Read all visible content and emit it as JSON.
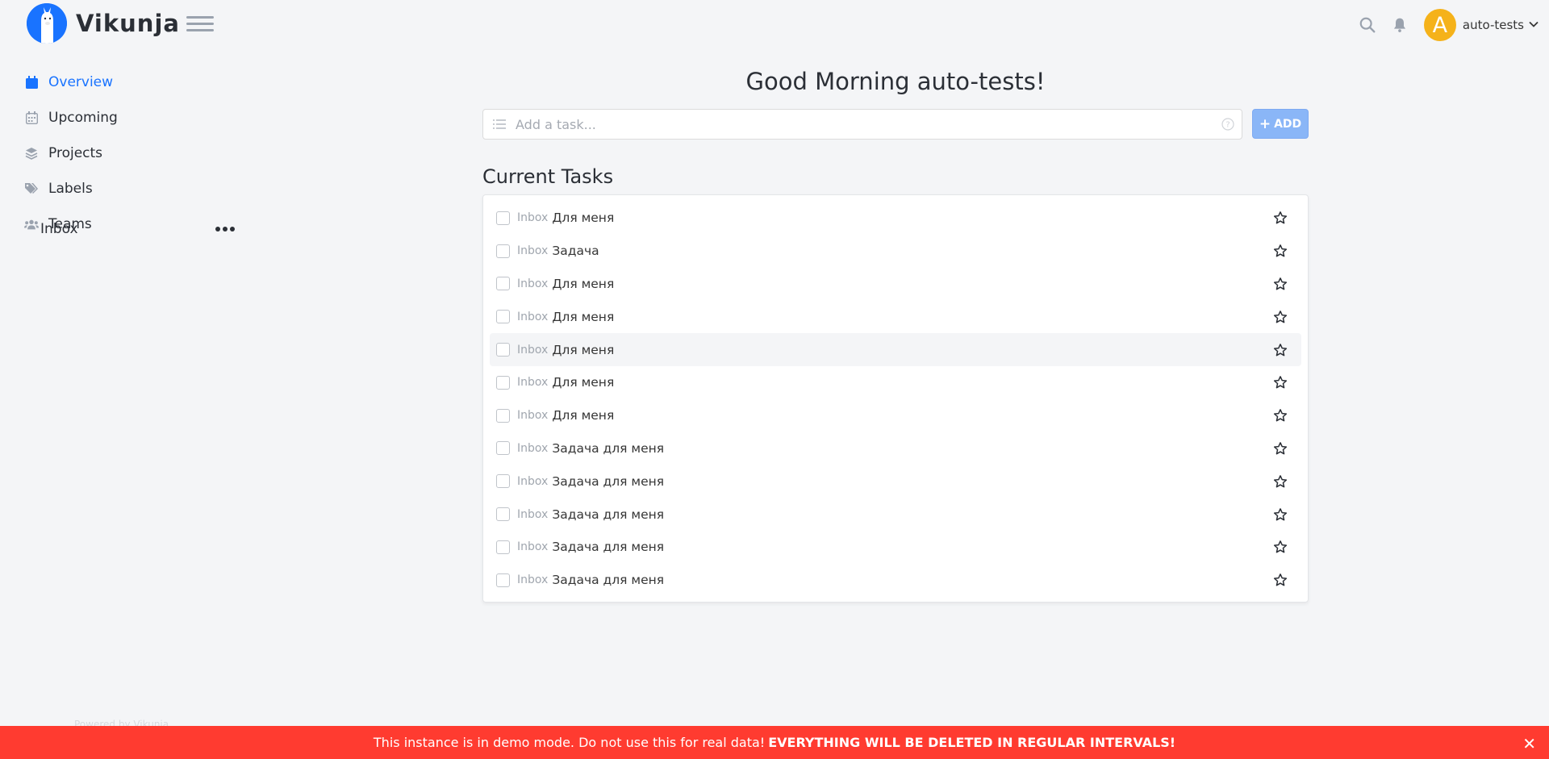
{
  "app": {
    "name": "Vikunja"
  },
  "header": {
    "username": "auto-tests",
    "avatar_letter": "A",
    "avatar_color": "#f5b21a"
  },
  "sidebar": {
    "items": [
      {
        "label": "Overview",
        "icon": "calendar-icon",
        "active": true
      },
      {
        "label": "Upcoming",
        "icon": "calendar-grid-icon"
      },
      {
        "label": "Projects",
        "icon": "layers-icon"
      },
      {
        "label": "Labels",
        "icon": "tags-icon"
      },
      {
        "label": "Teams",
        "icon": "users-icon"
      }
    ],
    "projects": [
      {
        "label": "Inbox"
      }
    ],
    "powered_by": "Powered by Vikunja"
  },
  "main": {
    "greeting": "Good Morning auto-tests!",
    "add_task": {
      "placeholder": "Add a task...",
      "button_label": "ADD",
      "button_icon": "+"
    },
    "section_title": "Current Tasks",
    "tasks": [
      {
        "project": "Inbox",
        "title": "Для меня"
      },
      {
        "project": "Inbox",
        "title": "Задача"
      },
      {
        "project": "Inbox",
        "title": "Для меня"
      },
      {
        "project": "Inbox",
        "title": "Для меня"
      },
      {
        "project": "Inbox",
        "title": "Для меня"
      },
      {
        "project": "Inbox",
        "title": "Для меня"
      },
      {
        "project": "Inbox",
        "title": "Для меня"
      },
      {
        "project": "Inbox",
        "title": "Задача для меня"
      },
      {
        "project": "Inbox",
        "title": "Задача для меня"
      },
      {
        "project": "Inbox",
        "title": "Задача для меня"
      },
      {
        "project": "Inbox",
        "title": "Задача для меня"
      },
      {
        "project": "Inbox",
        "title": "Задача для меня"
      }
    ]
  },
  "banner": {
    "text": "This instance is in demo mode. Do not use this for real data!",
    "emphasis": "EVERYTHING WILL BE DELETED IN REGULAR INTERVALS!",
    "close": "✕",
    "color": "#ff3b30"
  },
  "colors": {
    "accent": "#1973ff",
    "background": "#f4f5f7"
  }
}
